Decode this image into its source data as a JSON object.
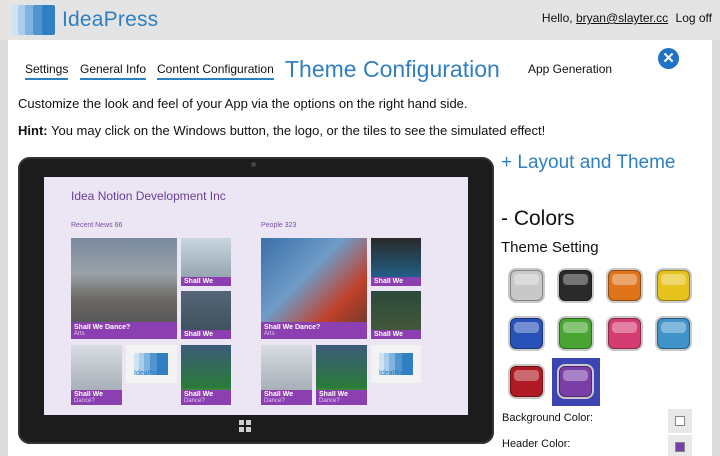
{
  "header": {
    "brand": "IdeaPress",
    "greeting": "Hello,",
    "user_email": "bryan@slayter.cc",
    "logoff_label": "Log off"
  },
  "steps": {
    "settings": "Settings",
    "general_info": "General Info",
    "content_config": "Content Configuration",
    "current": "Theme Configuration",
    "app_generation": "App Generation"
  },
  "close_icon": "close-icon",
  "intro_text": "Customize the look and feel of your App via the options on the right hand side.",
  "hint": {
    "label": "Hint:",
    "text": " You may click on the Windows button, the logo, or the tiles to see the simulated effect!"
  },
  "preview": {
    "app_title": "Idea Notion Development Inc",
    "sections": [
      "Recent News 66",
      "People 323"
    ],
    "tile_title": "Shall We Dance?",
    "tile_title_short": "Shall We",
    "tile_subtitle": "Arts",
    "tile_subtitle_short": "Dance?",
    "ideapress_tile_label": "IdeaPress",
    "windows_icon": "windows-logo-icon"
  },
  "side": {
    "layout_heading": "+ Layout and Theme",
    "colors_heading": "- Colors",
    "theme_setting": "Theme Setting",
    "swatches": [
      {
        "name": "silver",
        "color": "#c8c8c8"
      },
      {
        "name": "black",
        "color": "#2a2a2a"
      },
      {
        "name": "orange",
        "color": "#e0741a"
      },
      {
        "name": "yellow",
        "color": "#e6c21c"
      },
      {
        "name": "blue",
        "color": "#2952b8"
      },
      {
        "name": "green",
        "color": "#4aa632"
      },
      {
        "name": "pink",
        "color": "#d43c72"
      },
      {
        "name": "teal",
        "color": "#3f93c9"
      },
      {
        "name": "red",
        "color": "#b01a24"
      },
      {
        "name": "purple",
        "color": "#7a3ea8",
        "selected": true
      }
    ],
    "background_color_label": "Background Color:",
    "header_color_label": "Header Color:",
    "background_color": "#ffffff",
    "header_color": "#7a3ea8"
  },
  "colors": {
    "accent": "#2f7fc1",
    "tile_caption": "#8c3fb0",
    "selected_frame": "#3d45b2"
  }
}
